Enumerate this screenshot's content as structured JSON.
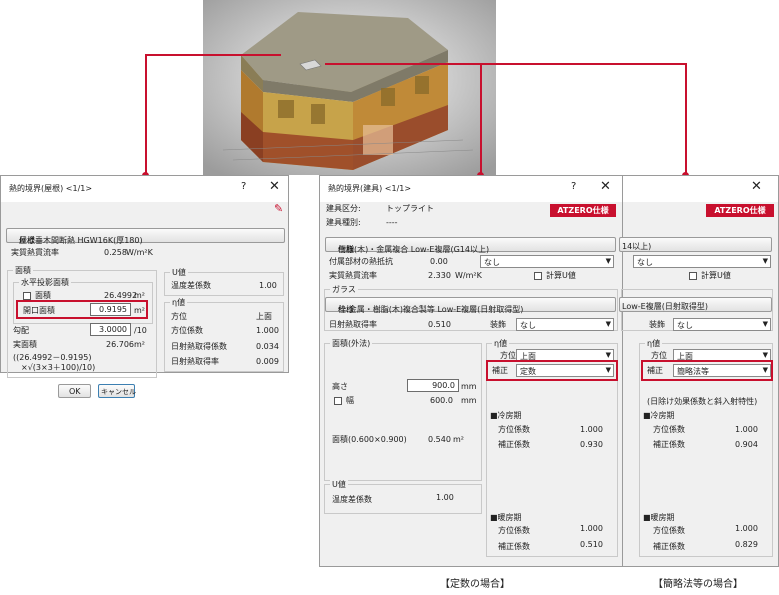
{
  "colors": {
    "accent": "#c8102e",
    "dialog_bg": "#f0f0f0"
  },
  "captions": {
    "teisu": "【定数の場合】",
    "kanryaku": "【簡略法等の場合】"
  },
  "dlg1": {
    "title": "熱的境界(屋根)  <1/1>",
    "help": "?",
    "close": "✕",
    "spec_label": "仕様",
    "spec_value": "屋根垂木間断熱 HGW16K(厚180)",
    "jisshitsu_label": "実質熱貫流率",
    "jisshitsu_value": "0.258",
    "jisshitsu_unit": "W/m²K",
    "menseki_group": "面積",
    "suihei_group": "水平投影面積",
    "menseki_label": "面積",
    "menseki_value": "26.4992",
    "menseki_unit": "m²",
    "kaiko_label": "開口面積",
    "kaiko_value": "0.9195",
    "kaiko_unit": "m²",
    "koubai_label": "勾配",
    "koubai_value": "3.0000",
    "koubai_unit": "/10",
    "jitsu_label": "実面積",
    "jitsu_value": "26.706",
    "jitsu_unit": "m²",
    "formula1": "((26.4992－0.9195)",
    "formula2": "×√(3×3＋100)/10)",
    "u_group": "U値",
    "ondo_label": "温度差係数",
    "ondo_value": "1.00",
    "eta_group": "η値",
    "houi_label": "方位",
    "houi_value": "上面",
    "houikeisu_label": "方位係数",
    "houikeisu_value": "1.000",
    "nissha_label": "日射熱取得係数",
    "nissha_value": "0.034",
    "nisshaR_label": "日射熱取得率",
    "nisshaR_value": "0.009",
    "ok": "OK",
    "cancel": "キャンセル"
  },
  "dlg2": {
    "title": "熱的境界(建具)  <1/1>",
    "help": "?",
    "close": "✕",
    "kubun_label": "建具区分:",
    "kubun_value": "トップライト",
    "shubetsu_label": "建具種別:",
    "shubetsu_value": "----",
    "atzero": "ATZERO仕様",
    "spec_label": "仕様",
    "spec_value": "樹脂(木)・金属複合 Low-E複層(G14以上)",
    "fuzoku_label": "付属部材の熱抵抗",
    "fuzoku_value": "0.00",
    "fuzoku_select": "なし",
    "jisshitsu_label": "実質熱貫流率",
    "jisshitsu_value": "2.330",
    "jisshitsu_unit": "W/m²K",
    "keisan_label": "計算U値",
    "glass_group": "ガラス",
    "gspec_label": "仕様",
    "gspec_value": "枠:金属・樹脂(木)複合製等 Low-E複層(日射取得型)",
    "nissha_label": "日射熱取得率",
    "nissha_value": "0.510",
    "soushoku_label": "装飾",
    "soushoku_value": "なし",
    "menseki_group": "面積(外法)",
    "takasa_label": "高さ",
    "takasa_value": "900.0",
    "takasa_unit": "mm",
    "haba_label": "幅",
    "haba_value": "600.0",
    "haba_unit": "mm",
    "menseki_label": "面積(0.600×0.900)",
    "menseki_value": "0.540",
    "menseki_unit": "m²",
    "u_group": "U値",
    "ondo_label": "温度差係数",
    "ondo_value": "1.00",
    "eta_group": "η値",
    "houi_label": "方位",
    "houi_value": "上面",
    "hosei_label": "補正",
    "hosei_value": "定数",
    "reibo_label": "■冷房期",
    "houikeisu_label": "方位係数",
    "reibo_houi": "1.000",
    "hoseikeisu_label": "補正係数",
    "reibo_hosei": "0.930",
    "danbo_label": "■暖房期",
    "danbo_houi": "1.000",
    "danbo_hosei": "0.510"
  },
  "dlg3": {
    "close": "✕",
    "atzero": "ATZERO仕様",
    "spec_partial": "14以上)",
    "fuzoku_select": "なし",
    "keisan_label": "計算U値",
    "gspec_partial": "Low-E複層(日射取得型)",
    "soushoku_label": "装飾",
    "soushoku_value": "なし",
    "eta_group": "η値",
    "houi_label": "方位",
    "houi_value": "上面",
    "hosei_label": "補正",
    "hosei_value": "簡略法等",
    "note": "(日除け効果係数と斜入射特性)",
    "reibo_label": "■冷房期",
    "houikeisu_label": "方位係数",
    "reibo_houi": "1.000",
    "hoseikeisu_label": "補正係数",
    "reibo_hosei": "0.904",
    "danbo_label": "■暖房期",
    "danbo_houi": "1.000",
    "danbo_hosei": "0.829"
  }
}
